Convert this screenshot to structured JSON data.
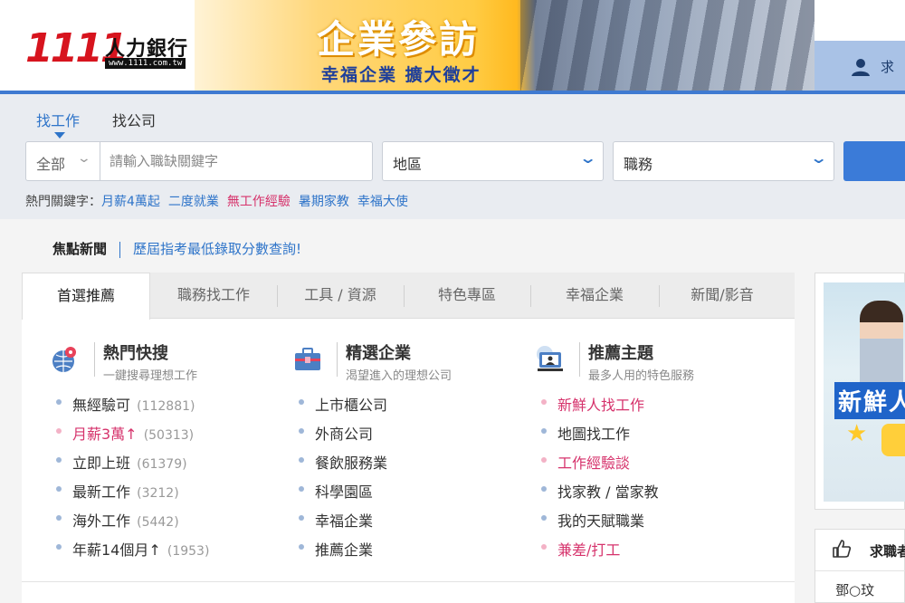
{
  "header": {
    "logo_number": "1111",
    "logo_text": "人力銀行",
    "logo_url": "www.1111.com.tw",
    "banner_title": "企業參訪",
    "banner_subtitle": "幸福企業 擴大徵才",
    "user_text": "求"
  },
  "search": {
    "tabs": [
      "找工作",
      "找公司"
    ],
    "category_select": "全部",
    "keyword_placeholder": "請輸入職缺關鍵字",
    "area_select": "地區",
    "job_select": "職務",
    "hot_label": "熱門關鍵字：",
    "hot_keywords": [
      {
        "text": "月薪4萬起",
        "color": "#2e74c9"
      },
      {
        "text": "二度就業",
        "color": "#2e74c9"
      },
      {
        "text": "無工作經驗",
        "color": "#d6336c"
      },
      {
        "text": "暑期家教",
        "color": "#2e74c9"
      },
      {
        "text": "幸福大使",
        "color": "#2e74c9"
      }
    ]
  },
  "news": {
    "label": "焦點新聞",
    "link": "歷屆指考最低錄取分數查詢!"
  },
  "tabs": [
    "首選推薦",
    "職務找工作",
    "工具 / 資源",
    "特色專區",
    "幸福企業",
    "新聞/影音"
  ],
  "columns": [
    {
      "icon": "globe-pin-icon",
      "title": "熱門快搜",
      "subtitle": "一鍵搜尋理想工作",
      "items": [
        {
          "label": "無經驗可",
          "count": "(112881)",
          "highlight": false
        },
        {
          "label": "月薪3萬↑",
          "count": "(50313)",
          "highlight": true
        },
        {
          "label": "立即上班",
          "count": "(61379)",
          "highlight": false
        },
        {
          "label": "最新工作",
          "count": "(3212)",
          "highlight": false
        },
        {
          "label": "海外工作",
          "count": "(5442)",
          "highlight": false
        },
        {
          "label": "年薪14個月↑",
          "count": "(1953)",
          "highlight": false
        }
      ]
    },
    {
      "icon": "briefcase-icon",
      "title": "精選企業",
      "subtitle": "渴望進入的理想公司",
      "items": [
        {
          "label": "上市櫃公司",
          "highlight": false
        },
        {
          "label": "外商公司",
          "highlight": false
        },
        {
          "label": "餐飲服務業",
          "highlight": false
        },
        {
          "label": "科學園區",
          "highlight": false
        },
        {
          "label": "幸福企業",
          "highlight": false
        },
        {
          "label": "推薦企業",
          "highlight": false
        }
      ]
    },
    {
      "icon": "computer-user-icon",
      "title": "推薦主題",
      "subtitle": "最多人用的特色服務",
      "items": [
        {
          "label": "新鮮人找工作",
          "highlight": true
        },
        {
          "label": "地圖找工作",
          "highlight": false
        },
        {
          "label": "工作經驗談",
          "highlight": true
        },
        {
          "label": "找家教 / 當家教",
          "highlight": false
        },
        {
          "label": "我的天賦職業",
          "highlight": false
        },
        {
          "label": "兼差/打工",
          "highlight": true
        }
      ]
    }
  ],
  "ad": {
    "text": "新鮮人"
  },
  "wish": {
    "title": "求職者",
    "name": "鄧○玟"
  }
}
